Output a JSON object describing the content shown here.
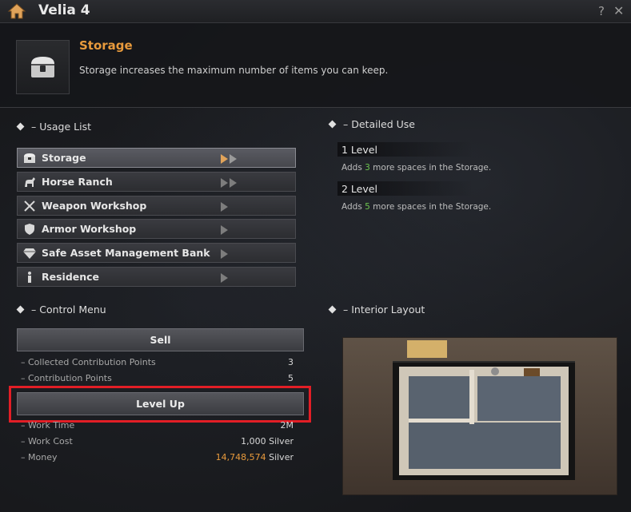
{
  "window": {
    "title": "Velia 4",
    "help_label": "?",
    "close_label": "✕",
    "home_icon": "house-icon"
  },
  "building": {
    "name": "Storage",
    "description": "Storage increases the maximum number of items you can keep.",
    "icon": "chest-icon"
  },
  "usage_list": {
    "heading": "– Usage List",
    "items": [
      {
        "label": "Storage",
        "icon": "storage-icon",
        "selected": true
      },
      {
        "label": "Horse Ranch",
        "icon": "horse-icon",
        "selected": false
      },
      {
        "label": "Weapon Workshop",
        "icon": "crossed-swords-icon",
        "selected": false
      },
      {
        "label": "Armor Workshop",
        "icon": "shield-icon",
        "selected": false
      },
      {
        "label": "Safe Asset Management Bank",
        "icon": "diamond-icon",
        "selected": false
      },
      {
        "label": "Residence",
        "icon": "person-icon",
        "selected": false
      }
    ]
  },
  "detailed_use": {
    "heading": "– Detailed Use",
    "levels": [
      {
        "level": "1 Level",
        "desc_pre": "Adds ",
        "amount": "3",
        "desc_post": " more spaces in the Storage."
      },
      {
        "level": "2 Level",
        "desc_pre": "Adds ",
        "amount": "5",
        "desc_post": " more spaces in the Storage."
      }
    ]
  },
  "control_menu": {
    "heading": "– Control Menu",
    "sell_label": "Sell",
    "level_up_label": "Level Up",
    "stats_top": [
      {
        "label": "– Collected Contribution Points",
        "value": "3"
      },
      {
        "label": "– Contribution Points",
        "value": "5"
      }
    ],
    "stats_bottom": [
      {
        "label": "– Work Time",
        "value": "2M",
        "unit": ""
      },
      {
        "label": "– Work Cost",
        "value": "1,000",
        "unit": " Silver"
      },
      {
        "label": "– Money",
        "value": "14,748,574",
        "unit": " Silver"
      }
    ]
  },
  "interior_layout": {
    "heading": "– Interior Layout"
  },
  "colors": {
    "accent": "#e89a3c",
    "highlight_green": "#6dc64f",
    "annotation_red": "#e21e26"
  }
}
